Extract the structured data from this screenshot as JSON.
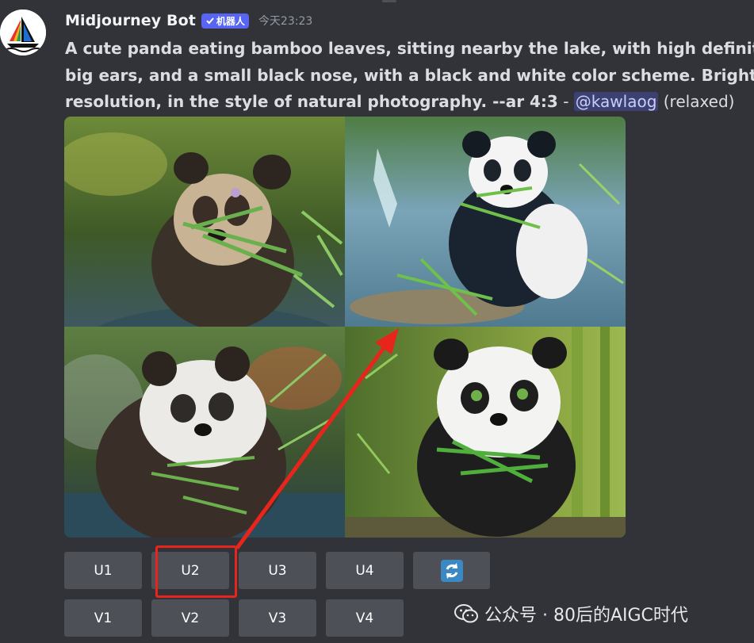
{
  "bot": {
    "name": "Midjourney Bot",
    "tag": "机器人",
    "timestamp": "今天23:23",
    "avatar": "sailboat-logo"
  },
  "message": {
    "line1": "A cute panda eating bamboo leaves, sitting nearby the lake, with high definition p",
    "line2": "big ears, and a small black nose, with a black and white color scheme. Bright colo",
    "line3": "resolution, in the style of natural photography. --ar 4:3",
    "separator": " - ",
    "mention": "@kawlaog",
    "status": " (relaxed)"
  },
  "images": [
    {
      "description": "panda-top-left"
    },
    {
      "description": "panda-top-right"
    },
    {
      "description": "panda-bottom-left"
    },
    {
      "description": "panda-bottom-right"
    }
  ],
  "buttons": {
    "upscale": [
      "U1",
      "U2",
      "U3",
      "U4"
    ],
    "variation": [
      "V1",
      "V2",
      "V3",
      "V4"
    ],
    "reroll_icon": "refresh-icon"
  },
  "annotation": {
    "highlighted": "U2",
    "highlight_color": "#e8251c",
    "arrow_target": "top-right image"
  },
  "watermark": {
    "icon": "wechat-icon",
    "text": "公众号 · 80后的AIGC时代"
  },
  "colors": {
    "background": "#313338",
    "button": "#4e5058",
    "bot_tag": "#5865f2",
    "mention_bg": "#3c4270",
    "reroll": "#3b88c3"
  }
}
